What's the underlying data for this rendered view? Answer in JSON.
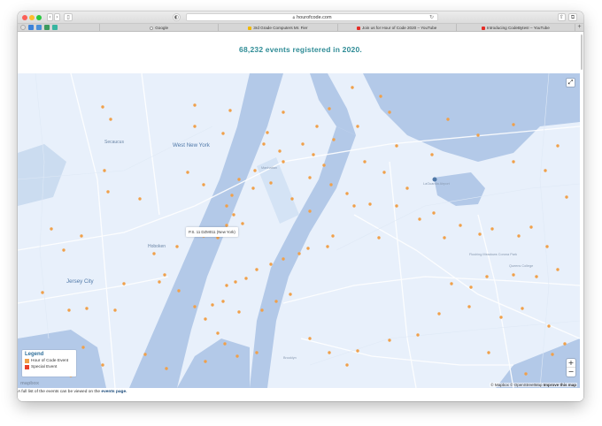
{
  "browser": {
    "url": "hourofcode.com",
    "favorites_tab": "Google",
    "tabs": [
      {
        "label": "3rd Grade Computers Mr. Fier",
        "icon_color": "#f0b800"
      },
      {
        "label": "Join us for Hour of Code 2020 – YouTube",
        "icon_color": "#e52d27"
      },
      {
        "label": "Introducing CodeBytes! – YouTube",
        "icon_color": "#e52d27"
      }
    ]
  },
  "page": {
    "headline": "68,232 events registered in 2020.",
    "headline_color": "#2f8c96"
  },
  "map": {
    "popup_text": "P.S. 11 DZM011 (New York)",
    "labels": {
      "west_new_york": "West New York",
      "secaucus": "Secaucus",
      "hoboken": "Hoboken",
      "jersey_city": "Jersey City",
      "manhattan": "Manhattan",
      "laguardia": "LaGuardia Airport",
      "flushing": "Flushing Meadows Corona Park",
      "queens": "Queens College",
      "brooklyn": "Brooklyn"
    },
    "legend": {
      "title": "Legend",
      "items": [
        {
          "label": "Hour of Code Event",
          "color": "#f0a04a"
        },
        {
          "label": "Special Event",
          "color": "#e8402a"
        }
      ]
    },
    "attribution": {
      "mapbox": "© Mapbox",
      "osm": "© OpenStreetMap",
      "improve": "Improve this map"
    },
    "logo_text": "mapbox",
    "marker_color": "#f0a04a",
    "water_color": "#b3c9e8",
    "land_color": "#e8f0fb"
  },
  "footer": {
    "prefix": "A full list of the events can be viewed on the ",
    "link": "events page."
  }
}
